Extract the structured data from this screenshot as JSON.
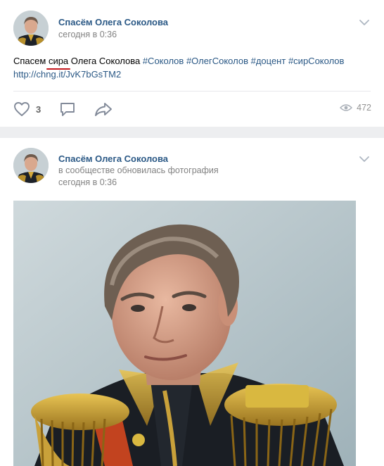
{
  "posts": [
    {
      "author": "Спасём Олега Соколова",
      "time": "сегодня в 0:36",
      "text": {
        "before": "Спасем ",
        "underlined": "сира",
        "after": " Олега Соколова ",
        "hashtags": [
          "#Соколов",
          "#ОлегСоколов",
          "#доцент",
          "#сирСоколов"
        ],
        "link": "http://chng.it/JvK7bGsTM2"
      },
      "actions": {
        "likes": "3",
        "views": "472"
      }
    },
    {
      "author": "Спасём Олега Соколова",
      "subtitle": "в сообществе обновилась фотография",
      "time": "сегодня в 0:36"
    }
  ],
  "icons": [
    "avatar-portrait",
    "chevron-down-icon",
    "heart-icon",
    "comment-icon",
    "share-icon",
    "eye-icon"
  ],
  "colors": {
    "link": "#2a5885",
    "meta": "#828282",
    "underline": "#c4161c",
    "background": "#edeef0"
  }
}
